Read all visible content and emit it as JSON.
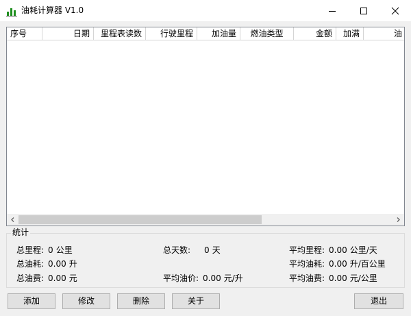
{
  "window": {
    "title": "油耗计算器 V1.0",
    "icon": "bar-chart-icon",
    "accent_color": "#1f8f1f"
  },
  "listview": {
    "columns": [
      "序号",
      "日期",
      "里程表读数",
      "行驶里程",
      "加油量",
      "燃油类型",
      "金额",
      "加满",
      "油"
    ],
    "rows": []
  },
  "stats": {
    "title": "统计",
    "total_mileage": {
      "label": "总里程:",
      "value": "0",
      "unit": "公里"
    },
    "total_days": {
      "label": "总天数:",
      "value": "0",
      "unit": "天"
    },
    "avg_mileage": {
      "label": "平均里程:",
      "value": "0.00",
      "unit": "公里/天"
    },
    "total_fuel": {
      "label": "总油耗:",
      "value": "0.00",
      "unit": "升"
    },
    "avg_fuel": {
      "label": "平均油耗:",
      "value": "0.00",
      "unit": "升/百公里"
    },
    "total_cost": {
      "label": "总油费:",
      "value": "0.00",
      "unit": "元"
    },
    "avg_price": {
      "label": "平均油价:",
      "value": "0.00",
      "unit": "元/升"
    },
    "avg_cost": {
      "label": "平均油费:",
      "value": "0.00",
      "unit": "元/公里"
    }
  },
  "buttons": {
    "add": "添加",
    "edit": "修改",
    "delete": "删除",
    "about": "关于",
    "exit": "退出"
  }
}
